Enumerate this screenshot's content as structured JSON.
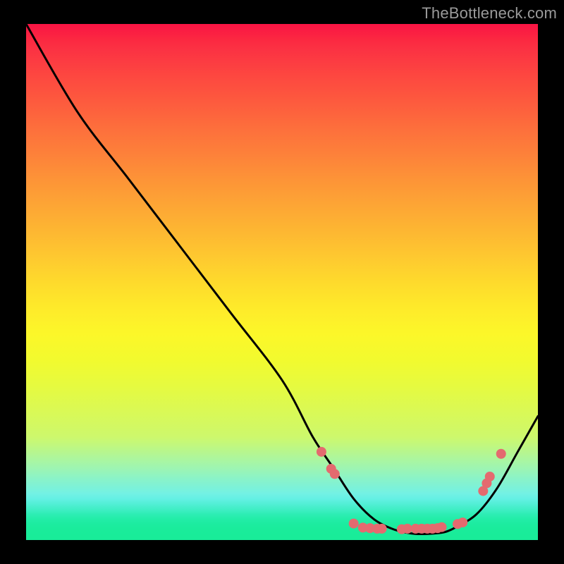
{
  "watermark": "TheBottleneck.com",
  "chart_data": {
    "type": "line",
    "title": "",
    "xlabel": "",
    "ylabel": "",
    "xlim": [
      0,
      100
    ],
    "ylim": [
      0,
      100
    ],
    "grid": false,
    "background_gradient": "rainbow-vertical",
    "series": [
      {
        "name": "curve",
        "color": "#000000",
        "stroke_width": 3,
        "x": [
          0,
          10,
          20,
          30,
          40,
          50,
          56,
          60,
          64,
          68,
          72,
          76,
          80,
          82,
          84,
          88,
          92,
          96,
          100
        ],
        "y": [
          100,
          83,
          70,
          57,
          44,
          31,
          20,
          14,
          8,
          4,
          2,
          1.2,
          1.3,
          1.6,
          2.5,
          5,
          10,
          17,
          24
        ]
      }
    ],
    "markers": {
      "color": "#e46a6f",
      "radius": 7,
      "points": [
        {
          "x": 57.7,
          "y": 17.1
        },
        {
          "x": 59.6,
          "y": 13.8
        },
        {
          "x": 60.3,
          "y": 12.8
        },
        {
          "x": 64.0,
          "y": 3.2
        },
        {
          "x": 65.8,
          "y": 2.4
        },
        {
          "x": 67.2,
          "y": 2.3
        },
        {
          "x": 68.6,
          "y": 2.2
        },
        {
          "x": 69.5,
          "y": 2.2
        },
        {
          "x": 73.4,
          "y": 2.1
        },
        {
          "x": 74.5,
          "y": 2.2
        },
        {
          "x": 76.1,
          "y": 2.2
        },
        {
          "x": 77.3,
          "y": 2.2
        },
        {
          "x": 78.4,
          "y": 2.2
        },
        {
          "x": 79.4,
          "y": 2.2
        },
        {
          "x": 80.4,
          "y": 2.3
        },
        {
          "x": 81.2,
          "y": 2.5
        },
        {
          "x": 84.3,
          "y": 3.1
        },
        {
          "x": 85.3,
          "y": 3.4
        },
        {
          "x": 89.3,
          "y": 9.5
        },
        {
          "x": 90.0,
          "y": 11.0
        },
        {
          "x": 90.6,
          "y": 12.3
        },
        {
          "x": 92.8,
          "y": 16.7
        }
      ]
    }
  }
}
